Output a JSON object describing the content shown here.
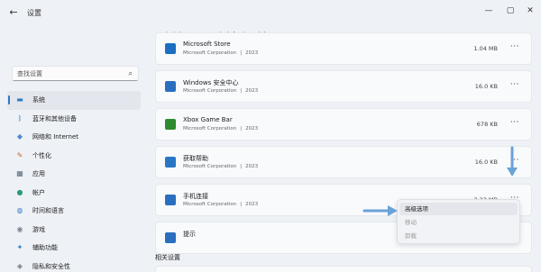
{
  "window": {
    "app_title": "设置",
    "back_glyph": "←",
    "minimize_glyph": "—",
    "maximize_glyph": "▢",
    "close_glyph": "✕"
  },
  "breadcrumb": {
    "parent": "系统",
    "separator": "›",
    "current": "系统组件"
  },
  "search": {
    "placeholder": "查找设置",
    "icon": "search-icon",
    "icon_glyph": "⌕"
  },
  "sidebar": {
    "items": [
      {
        "label": "系统",
        "icon": "monitor-icon",
        "glyph": "▬",
        "color": "#2a7bc4",
        "active": true
      },
      {
        "label": "蓝牙和其他设备",
        "icon": "bluetooth-icon",
        "glyph": "ᛒ",
        "color": "#2a7bc4"
      },
      {
        "label": "网络和 Internet",
        "icon": "wifi-icon",
        "glyph": "◆",
        "color": "#4a8ad0"
      },
      {
        "label": "个性化",
        "icon": "brush-icon",
        "glyph": "✎",
        "color": "#c4682a"
      },
      {
        "label": "应用",
        "icon": "apps-icon",
        "glyph": "▦",
        "color": "#5a6a7a"
      },
      {
        "label": "帐户",
        "icon": "account-icon",
        "glyph": "●",
        "color": "#2e9a78"
      },
      {
        "label": "时间和语言",
        "icon": "globe-icon",
        "glyph": "◍",
        "color": "#3a7fc8"
      },
      {
        "label": "游戏",
        "icon": "gamepad-icon",
        "glyph": "◉",
        "color": "#7a8592"
      },
      {
        "label": "辅助功能",
        "icon": "accessibility-icon",
        "glyph": "✦",
        "color": "#2a7bc4"
      },
      {
        "label": "隐私和安全性",
        "icon": "shield-icon",
        "glyph": "◈",
        "color": "#6a7380"
      }
    ]
  },
  "components": [
    {
      "name": "Microsoft Store",
      "publisher": "Microsoft Corporation",
      "divider": "|",
      "year": "2023",
      "size": "1.04 MB",
      "icon": "store-icon",
      "icon_color": "#1c6fc0"
    },
    {
      "name": "Windows 安全中心",
      "publisher": "Microsoft Corporation",
      "divider": "|",
      "year": "2023",
      "size": "16.0 KB",
      "icon": "security-icon",
      "icon_color": "#2a6fbf"
    },
    {
      "name": "Xbox Game Bar",
      "publisher": "Microsoft Corporation",
      "divider": "|",
      "year": "2023",
      "size": "678 KB",
      "icon": "xbox-icon",
      "icon_color": "#2e8a2e"
    },
    {
      "name": "获取帮助",
      "publisher": "Microsoft Corporation",
      "divider": "|",
      "year": "2023",
      "size": "16.0 KB",
      "icon": "help-icon",
      "icon_color": "#2a76c6"
    },
    {
      "name": "手机连接",
      "publisher": "Microsoft Corporation",
      "divider": "|",
      "year": "2023",
      "size": "3.23 MB",
      "icon": "phone-link-icon",
      "icon_color": "#2a6fbf"
    },
    {
      "name": "提示",
      "publisher": "",
      "divider": "",
      "year": "",
      "size": "",
      "icon": "tips-icon",
      "icon_color": "#2a6fbf"
    }
  ],
  "more_glyph": "···",
  "context_menu": {
    "items": [
      {
        "label": "高级选项",
        "enabled": true
      },
      {
        "label": "移动",
        "enabled": false
      },
      {
        "label": "卸载",
        "enabled": false
      }
    ]
  },
  "related_settings": {
    "title": "相关设置"
  },
  "annotation_color": "#6aa3d8"
}
